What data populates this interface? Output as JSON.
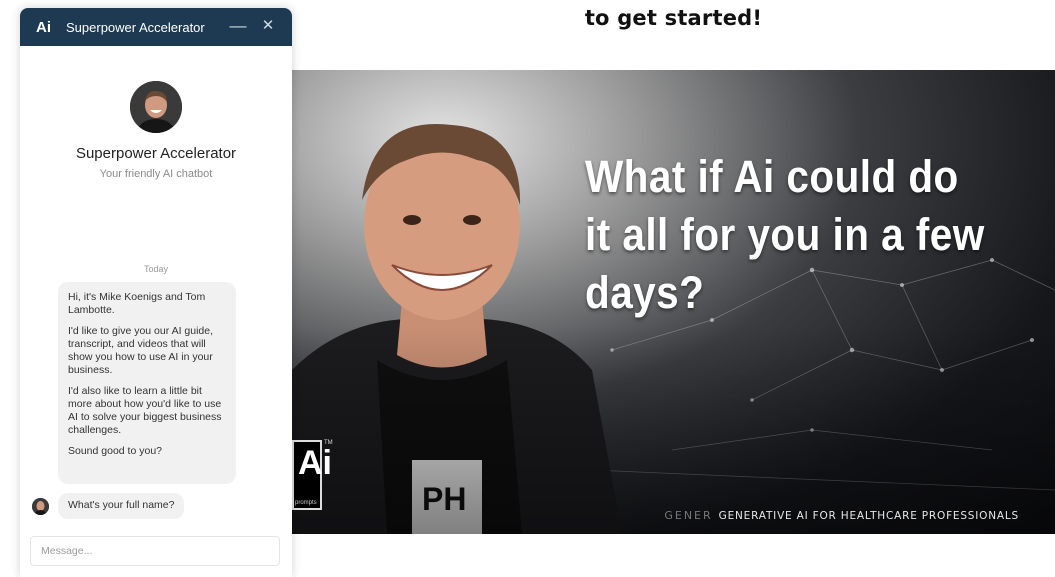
{
  "page": {
    "heading": "to get started!"
  },
  "video": {
    "headline": "What if Ai could do it all for you in a few days?",
    "tagline_faded": "GENER",
    "tagline": "GENERATIVE AI FOR HEALTHCARE PROFESSIONALS",
    "badge_big": "Ai",
    "badge_small": "prompts",
    "tm": "TM",
    "shirt_text": "PH"
  },
  "chat": {
    "header": {
      "logo": "Ai",
      "title": "Superpower Accelerator",
      "minimize": "—",
      "close": "✕"
    },
    "profile": {
      "name": "Superpower Accelerator",
      "subtitle": "Your friendly AI chatbot"
    },
    "day_label": "Today",
    "messages": [
      "Hi, it's Mike Koenigs and Tom Lambotte.",
      "I'd like to give you our AI guide, transcript, and videos that will show you how to use AI in your business.",
      "I'd also like to learn a little bit more about how you'd like to use AI to solve your biggest business challenges.",
      "Sound good to you?"
    ],
    "question": "What's your full name?",
    "composer_placeholder": "Message..."
  },
  "colors": {
    "header_bg": "#1e3a52",
    "bubble_bg": "#f1f1f1",
    "headline": "#ffffff"
  }
}
